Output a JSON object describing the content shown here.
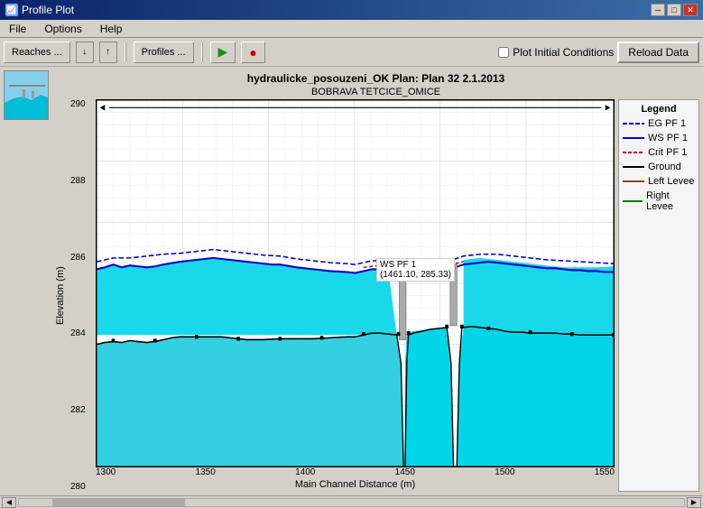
{
  "titleBar": {
    "title": "Profile Plot",
    "minBtn": "─",
    "maxBtn": "□",
    "closeBtn": "✕"
  },
  "menu": {
    "items": [
      "File",
      "Options",
      "Help"
    ]
  },
  "toolbar": {
    "reachesBtn": "Reaches ...",
    "downArrow": "↓",
    "upArrow": "↑",
    "profilesBtn": "Profiles ...",
    "playBtn": "▶",
    "recordBtn": "●",
    "plotConditionsLabel": "Plot Initial Conditions",
    "reloadBtn": "Reload Data"
  },
  "chart": {
    "title": "hydraulicke_posouzeni_OK    Plan: Plan 32   2.1.2013",
    "subtitle": "BOBRAVA TETCICE_OMICE",
    "yAxisLabel": "Elevation (m)",
    "xAxisLabel": "Main Channel Distance (m)",
    "yTickMin": 280,
    "yTickMax": 290,
    "yTicks": [
      "290",
      "288",
      "286",
      "284",
      "282",
      "280"
    ],
    "xTicks": [
      "1300",
      "1350",
      "1400",
      "1450",
      "1500",
      "1550"
    ],
    "legend": {
      "title": "Legend",
      "items": [
        {
          "label": "EG  PF 1",
          "color": "#0000ff",
          "style": "dashed"
        },
        {
          "label": "WS  PF 1",
          "color": "#0000ff",
          "style": "solid"
        },
        {
          "label": "Crit  PF 1",
          "color": "#ff0000",
          "style": "dashed"
        },
        {
          "label": "Ground",
          "color": "#000000",
          "style": "solid"
        },
        {
          "label": "Left Levee",
          "color": "#8B4513",
          "style": "solid"
        },
        {
          "label": "Right Levee",
          "color": "#008000",
          "style": "solid"
        }
      ]
    },
    "tooltip": {
      "label": "WS  PF 1",
      "x": "1461.10",
      "y": "285.33"
    }
  }
}
